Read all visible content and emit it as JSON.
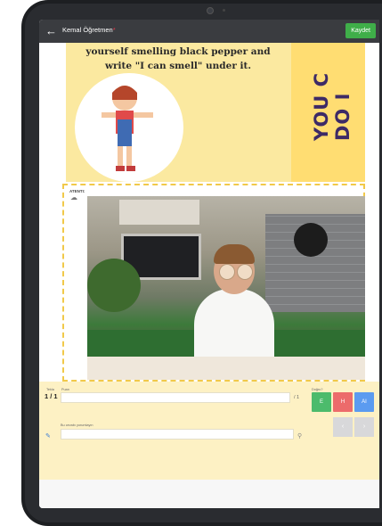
{
  "header": {
    "back_icon": "arrow-left-icon",
    "title": "Kemal Öğretmen",
    "required_mark": "*",
    "save_label": "Kaydet"
  },
  "worksheet": {
    "instruction_line1": "yourself smelling black pepper and",
    "instruction_line2": "write \"I can smell\" under it.",
    "side_text": "YOU C DO I"
  },
  "attention": {
    "label": "ATENTI:",
    "icon": "cloud-icon"
  },
  "grading": {
    "task_label": "Tekla",
    "task_value": "1 / 1",
    "score_label": "Puan",
    "score_max": "/ 1",
    "correct_label": "Doğru?",
    "comment_placeholder": "Bu cevabı yorumlayın",
    "btn_correct": "E",
    "btn_wrong": "H",
    "btn_ai": "AI",
    "edit_icon": "pencil-icon",
    "attach_icon": "paperclip-icon",
    "prev_icon": "chevron-left-icon",
    "next_icon": "chevron-right-icon"
  },
  "colors": {
    "toolbar": "#3a3c40",
    "save": "#3fae49",
    "correct": "#4cbb6c",
    "wrong": "#ec6b6b",
    "ai": "#5b9bf0",
    "accent_yellow": "#fdf1c4"
  }
}
